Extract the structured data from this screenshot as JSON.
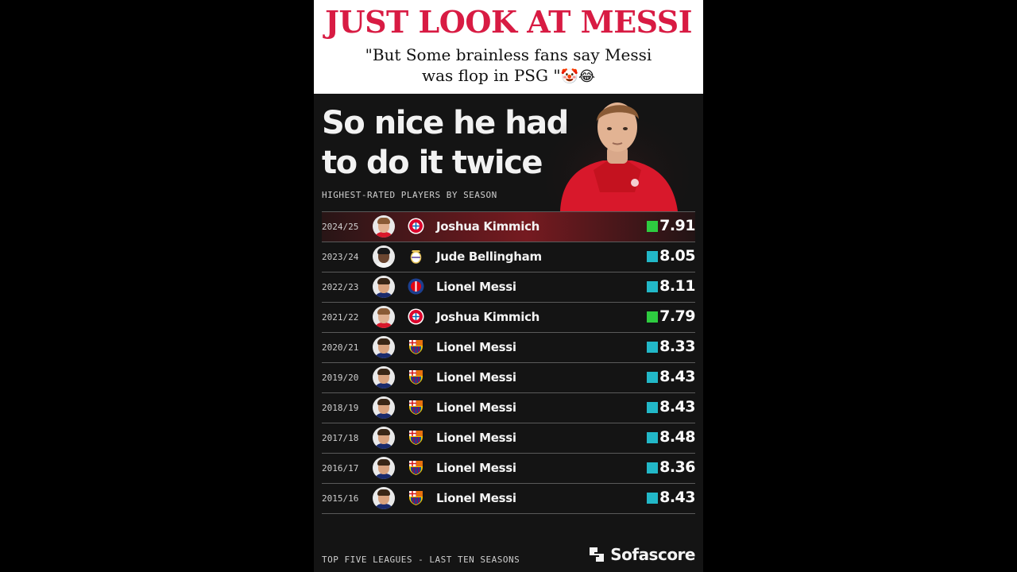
{
  "caption": {
    "headline": "JUST LOOK AT MESSI",
    "line1": "\"But Some brainless fans say Messi",
    "line2": "was flop in PSG \"",
    "emojis": "🤡😂"
  },
  "card": {
    "title_line1": "So nice he had",
    "title_line2": "to do it twice",
    "subtitle": "HIGHEST-RATED PLAYERS BY SEASON",
    "footer": "TOP FIVE LEAGUES - LAST TEN SEASONS",
    "brand": "Sofascore"
  },
  "colors": {
    "headline": "#d81b43",
    "swatch_green": "#2ecc40",
    "swatch_teal": "#22b8c8",
    "bayern": "#dc052d",
    "madrid": "#e8c45a",
    "psg": "#1d3f8f",
    "barca": "#a50044"
  },
  "rows": [
    {
      "season": "2024/25",
      "player": "Joshua Kimmich",
      "club": "bayern-crest-icon",
      "rating": "7.91",
      "swatch": "green"
    },
    {
      "season": "2023/24",
      "player": "Jude Bellingham",
      "club": "real-madrid-crest-icon",
      "rating": "8.05",
      "swatch": "teal"
    },
    {
      "season": "2022/23",
      "player": "Lionel Messi",
      "club": "psg-crest-icon",
      "rating": "8.11",
      "swatch": "teal"
    },
    {
      "season": "2021/22",
      "player": "Joshua Kimmich",
      "club": "bayern-crest-icon",
      "rating": "7.79",
      "swatch": "green"
    },
    {
      "season": "2020/21",
      "player": "Lionel Messi",
      "club": "barcelona-crest-icon",
      "rating": "8.33",
      "swatch": "teal"
    },
    {
      "season": "2019/20",
      "player": "Lionel Messi",
      "club": "barcelona-crest-icon",
      "rating": "8.43",
      "swatch": "teal"
    },
    {
      "season": "2018/19",
      "player": "Lionel Messi",
      "club": "barcelona-crest-icon",
      "rating": "8.43",
      "swatch": "teal"
    },
    {
      "season": "2017/18",
      "player": "Lionel Messi",
      "club": "barcelona-crest-icon",
      "rating": "8.48",
      "swatch": "teal"
    },
    {
      "season": "2016/17",
      "player": "Lionel Messi",
      "club": "barcelona-crest-icon",
      "rating": "8.36",
      "swatch": "teal"
    },
    {
      "season": "2015/16",
      "player": "Lionel Messi",
      "club": "barcelona-crest-icon",
      "rating": "8.43",
      "swatch": "teal"
    }
  ]
}
